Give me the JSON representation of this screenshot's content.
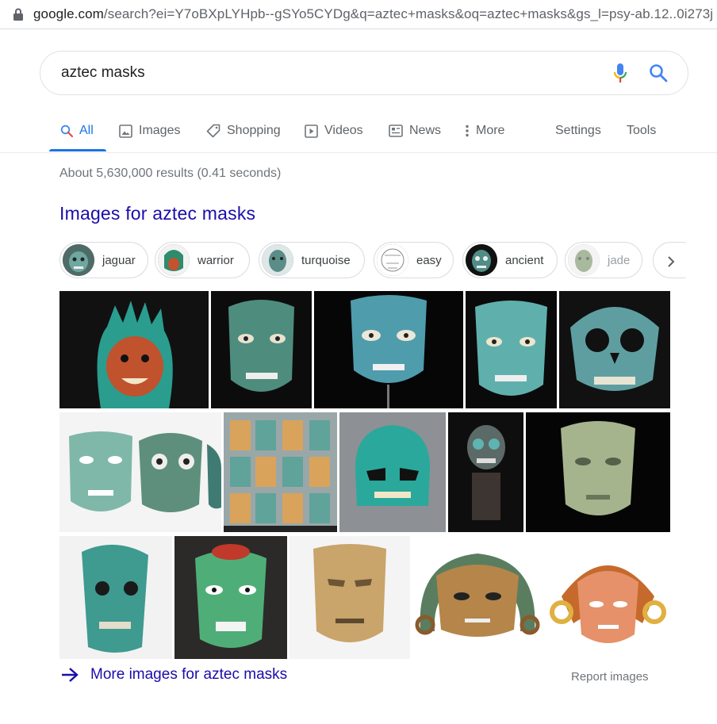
{
  "address_bar": {
    "host": "google.com",
    "path": "/search?ei=Y7oBXpLYHpb--gSYo5CYDg&q=aztec+masks&oq=aztec+masks&gs_l=psy-ab.12..0i273j"
  },
  "search": {
    "query": "aztec masks"
  },
  "tabs": {
    "all": "All",
    "images": "Images",
    "shopping": "Shopping",
    "videos": "Videos",
    "news": "News",
    "more": "More",
    "settings": "Settings",
    "tools": "Tools"
  },
  "result_stats": "About 5,630,000 results (0.41 seconds)",
  "images_heading": "Images for aztec masks",
  "chips": [
    {
      "label": "jaguar"
    },
    {
      "label": "warrior"
    },
    {
      "label": "turquoise"
    },
    {
      "label": "easy"
    },
    {
      "label": "ancient"
    },
    {
      "label": "jade"
    }
  ],
  "more_images": "More images for aztec masks",
  "report_images": "Report images",
  "colors": {
    "link": "#1a0dab",
    "accent": "#1a73e8",
    "muted": "#70757a"
  }
}
